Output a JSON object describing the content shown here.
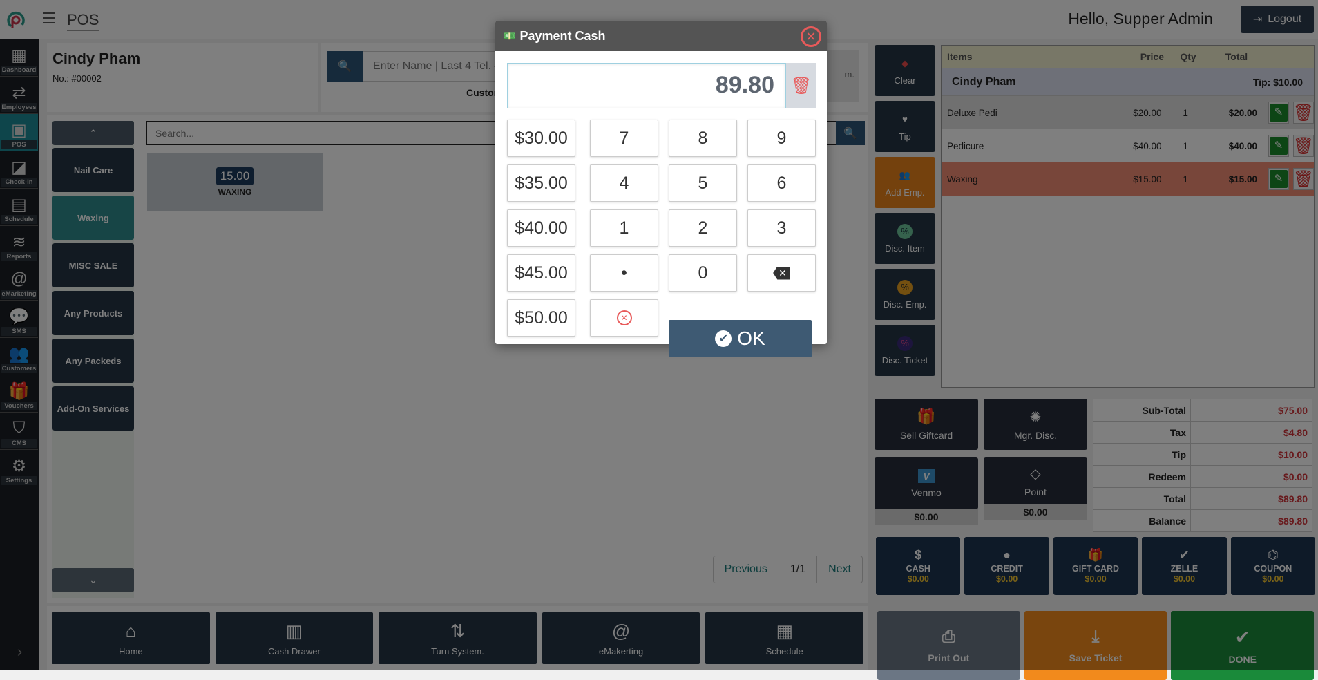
{
  "header": {
    "app_title": "POS",
    "greeting": "Hello, Supper Admin",
    "logout_label": "Logout"
  },
  "sidebar": {
    "items": [
      {
        "label": "Dashboard",
        "icon": "grid-icon"
      },
      {
        "label": "Employees",
        "icon": "employees-icon"
      },
      {
        "label": "POS",
        "icon": "pos-icon",
        "active": true
      },
      {
        "label": "Check-In",
        "icon": "check-in-icon"
      },
      {
        "label": "Schedule",
        "icon": "calendar-icon"
      },
      {
        "label": "Reports",
        "icon": "database-icon"
      },
      {
        "label": "eMarketing",
        "icon": "at-icon"
      },
      {
        "label": "SMS",
        "icon": "chat-icon"
      },
      {
        "label": "Customers",
        "icon": "users-icon"
      },
      {
        "label": "Vouchers",
        "icon": "gift-icon"
      },
      {
        "label": "CMS",
        "icon": "shield-icon"
      },
      {
        "label": "Settings",
        "icon": "gear-icon"
      }
    ]
  },
  "customer": {
    "name": "Cindy Pham",
    "number": "No.: #00002",
    "search_placeholder": "Enter Name | Last 4 Tel. #",
    "customer_label": "Customer",
    "side_note": "m."
  },
  "categories": {
    "items": [
      "Nail Care",
      "Waxing",
      "MISC SALE",
      "Any Products",
      "Any Packeds",
      "Add-On Services"
    ],
    "active": "Waxing"
  },
  "services": {
    "search_placeholder": "Search...",
    "tiles": [
      {
        "price": "15.00",
        "name": "WAXING"
      }
    ]
  },
  "pager": {
    "previous": "Previous",
    "page": "1/1",
    "next": "Next"
  },
  "bottom_toolbar": [
    "Home",
    "Cash Drawer",
    "Turn System.",
    "eMakerting",
    "Schedule"
  ],
  "actions": [
    "Clear",
    "Tip",
    "Add Emp.",
    "Disc. Item",
    "Disc. Emp.",
    "Disc. Ticket"
  ],
  "ticket": {
    "columns": [
      "Items",
      "Price",
      "Qty",
      "Total"
    ],
    "customer_name": "Cindy Pham",
    "tip_label": "Tip: $10.00",
    "rows": [
      {
        "item": "Deluxe Pedi",
        "price": "$20.00",
        "qty": "1",
        "total": "$20.00"
      },
      {
        "item": "Pedicure",
        "price": "$40.00",
        "qty": "1",
        "total": "$40.00"
      },
      {
        "item": "Waxing",
        "price": "$15.00",
        "qty": "1",
        "total": "$15.00"
      }
    ]
  },
  "extras": {
    "sell_giftcard": "Sell Giftcard",
    "mgr_disc": "Mgr. Disc.",
    "venmo": "Venmo",
    "venmo_value": "$0.00",
    "point": "Point",
    "point_value": "$0.00"
  },
  "totals": [
    {
      "label": "Sub-Total",
      "value": "$75.00"
    },
    {
      "label": "Tax",
      "value": "$4.80"
    },
    {
      "label": "Tip",
      "value": "$10.00"
    },
    {
      "label": "Redeem",
      "value": "$0.00"
    },
    {
      "label": "Total",
      "value": "$89.80"
    },
    {
      "label": "Balance",
      "value": "$89.80"
    }
  ],
  "payments": [
    {
      "label": "CASH",
      "value": "$0.00"
    },
    {
      "label": "CREDIT",
      "value": "$0.00"
    },
    {
      "label": "GIFT CARD",
      "value": "$0.00"
    },
    {
      "label": "ZELLE",
      "value": "$0.00"
    },
    {
      "label": "COUPON",
      "value": "$0.00"
    }
  ],
  "final": {
    "print": "Print Out",
    "save": "Save Ticket",
    "done": "DONE"
  },
  "modal": {
    "title": "Payment Cash",
    "amount": "89.80",
    "quick_amounts": [
      "$30.00",
      "$35.00",
      "$40.00",
      "$45.00",
      "$50.00"
    ],
    "digits": [
      "7",
      "8",
      "9",
      "4",
      "5",
      "6",
      "1",
      "2",
      "3",
      "•",
      "0"
    ],
    "ok_label": "OK"
  },
  "colors": {
    "accent": "#1d8a96",
    "ok": "#3e5a73",
    "done": "#1a7a34",
    "save": "#e8821a",
    "danger": "#e85a5a"
  }
}
